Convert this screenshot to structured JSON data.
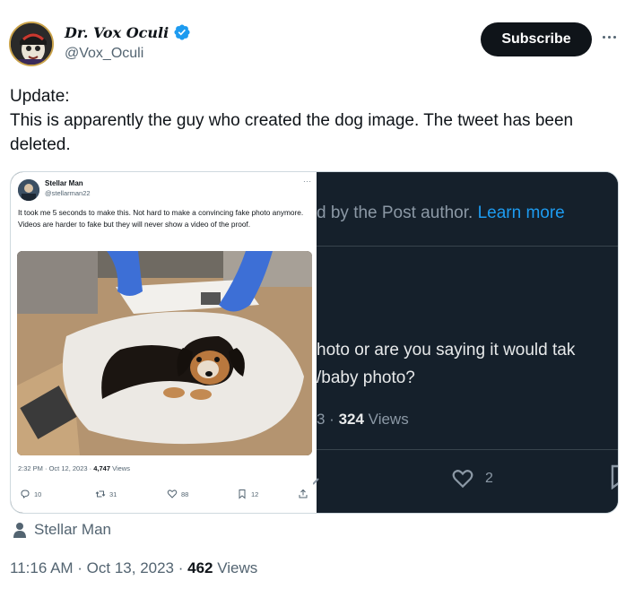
{
  "author": {
    "display_name": "Dr. Vox Oculi",
    "handle": "@Vox_Oculi",
    "verified_icon": "verified-badge-icon",
    "accent": "#1d9bf0"
  },
  "header": {
    "subscribe_label": "Subscribe",
    "more_icon": "more-horizontal-icon"
  },
  "tweet": {
    "line1": "Update:",
    "line2": "This is apparently the guy who created the dog image. The tweet has been deleted."
  },
  "embedded_left": {
    "name": "Stellar Man",
    "handle": "@stellarman22",
    "more": "···",
    "text": "It took me 5 seconds to make this. Not hard to make a convincing fake photo anymore. Videos are harder to fake but they will never show a video of the proof.",
    "meta_prefix": "2:32 PM · Oct 12, 2023 · ",
    "meta_views": "4,747",
    "meta_views_label": "Views",
    "actions": {
      "replies": "10",
      "retweets": "31",
      "likes": "88",
      "bookmarks": "12"
    }
  },
  "embedded_right": {
    "notice": "d by the Post author.",
    "learn_more": "Learn more",
    "text_line1": "hoto or are you saying it would tak",
    "text_line2": "/baby photo?",
    "views_prefix": "3 · ",
    "views_count": "324",
    "views_label": "Views",
    "likes": "2"
  },
  "tagged_user": "Stellar Man",
  "footer": {
    "timestamp": "11:16 AM · Oct 13, 2023 · ",
    "views_count": "462",
    "views_label": "Views"
  }
}
